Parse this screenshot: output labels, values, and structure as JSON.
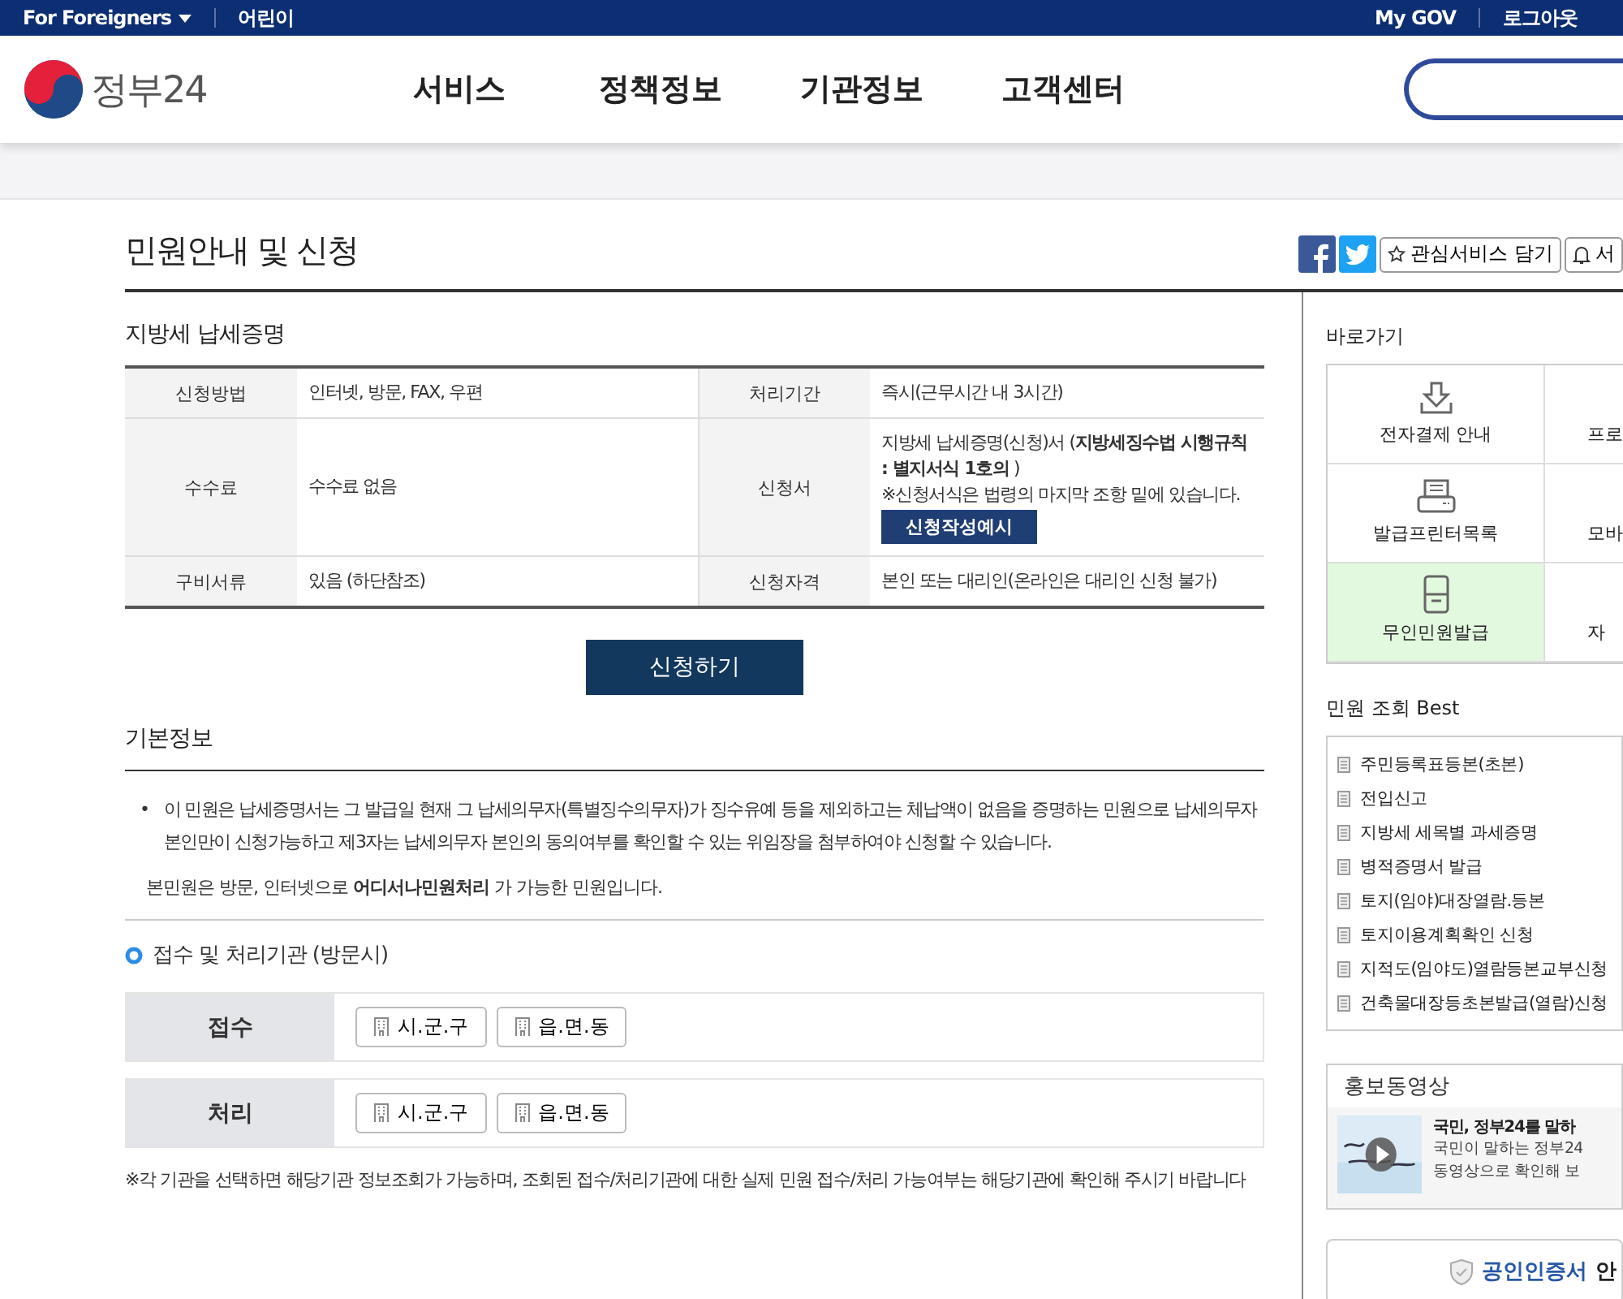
{
  "top_bar": {
    "left": [
      {
        "label": "For Foreigners",
        "dropdown": true
      },
      {
        "label": "어린이",
        "dropdown": false
      }
    ],
    "right": [
      "My GOV",
      "로그아웃"
    ]
  },
  "header": {
    "logo_text": "정부24",
    "nav": [
      "서비스",
      "정책정보",
      "기관정보",
      "고객센터"
    ]
  },
  "page_title": "민원안내 및 신청",
  "page_actions": [
    {
      "label": "관심서비스 담기",
      "kind": "star"
    },
    {
      "label": "서",
      "kind": "bell"
    }
  ],
  "summary": {
    "title": "지방세 납세증명",
    "rows": [
      [
        {
          "label": "신청방법",
          "value": "인터넷, 방문, FAX, 우편"
        },
        {
          "label": "처리기간",
          "value": "즉시(근무시간 내 3시간)"
        }
      ],
      [
        {
          "label": "수수료",
          "value": "수수료 없음"
        },
        {
          "label": "신청서",
          "value": "지방세 납세증명(신청)서 (**지방세징수법 시행규칙 : 별지서식 1호의** )",
          "note": "※신청서식은 법령의 마지막 조항 밑에 있습니다.",
          "button": "신청작성예시"
        }
      ],
      [
        {
          "label": "구비서류",
          "value": "있음 (하단참조)"
        },
        {
          "label": "신청자격",
          "value": "본인 또는 대리인(온라인은 대리인 신청 불가)"
        }
      ]
    ]
  },
  "apply_button": "신청하기",
  "basic_info": {
    "title": "기본정보",
    "marker": "•",
    "bullets": [
      "이 민원은 납세증명서는 그 발급일 현재 그 납세의무자(특별징수의무자)가 징수유예 등을 제외하고는 체납액이 없음을 증명하는 민원으로 납세의무자 본인만이 신청가능하고 제3자는 납세의무자 본인의 동의여부를 확인할 수 있는 위임장을 첨부하여야 신청할 수 있습니다."
    ],
    "note": "본민원은 방문, 인터넷으로 **어디서나민원처리** 가 가능한 민원입니다."
  },
  "offices": {
    "title": "접수 및 처리기관 (방문시)",
    "rows": [
      {
        "label": "접수",
        "buttons": [
          "시.군.구",
          "읍.면.동"
        ]
      },
      {
        "label": "처리",
        "buttons": [
          "시.군.구",
          "읍.면.동"
        ]
      }
    ],
    "footnote": "※각 기관을 선택하면 해당기관 정보조회가 가능하며, 조회된 접수/처리기관에 대한 실제 민원 접수/처리 가능여부는 해당기관에 확인해 주시기 바랍니다"
  },
  "quick_links": {
    "title": "바로가기",
    "items": [
      {
        "label": "전자결제 안내",
        "kind": "download",
        "highlighted": false
      },
      {
        "label": "프로",
        "kind": "none",
        "highlighted": false
      },
      {
        "label": "발급프린터목록",
        "kind": "printer",
        "highlighted": false
      },
      {
        "label": "모바",
        "kind": "none",
        "highlighted": false
      },
      {
        "label": "무인민원발급",
        "kind": "kiosk",
        "highlighted": true
      },
      {
        "label": "자",
        "kind": "none",
        "highlighted": false
      }
    ]
  },
  "best": {
    "title": "민원 조회 Best",
    "items": [
      "주민등록표등본(초본)",
      "전입신고",
      "지방세 세목별 과세증명",
      "병적증명서 발급",
      "토지(임야)대장열람.등본",
      "토지이용계획확인 신청",
      "지적도(임야도)열람등본교부신청",
      "건축물대장등초본발급(열람)신청"
    ]
  },
  "video": {
    "title": "홍보동영상",
    "item_title": "국민, 정부24를 말하",
    "description": [
      "국민이 말하는 정부24",
      "동영상으로 확인해 보"
    ]
  },
  "cert_link": {
    "link": "공인인증서",
    "rest": "안"
  }
}
